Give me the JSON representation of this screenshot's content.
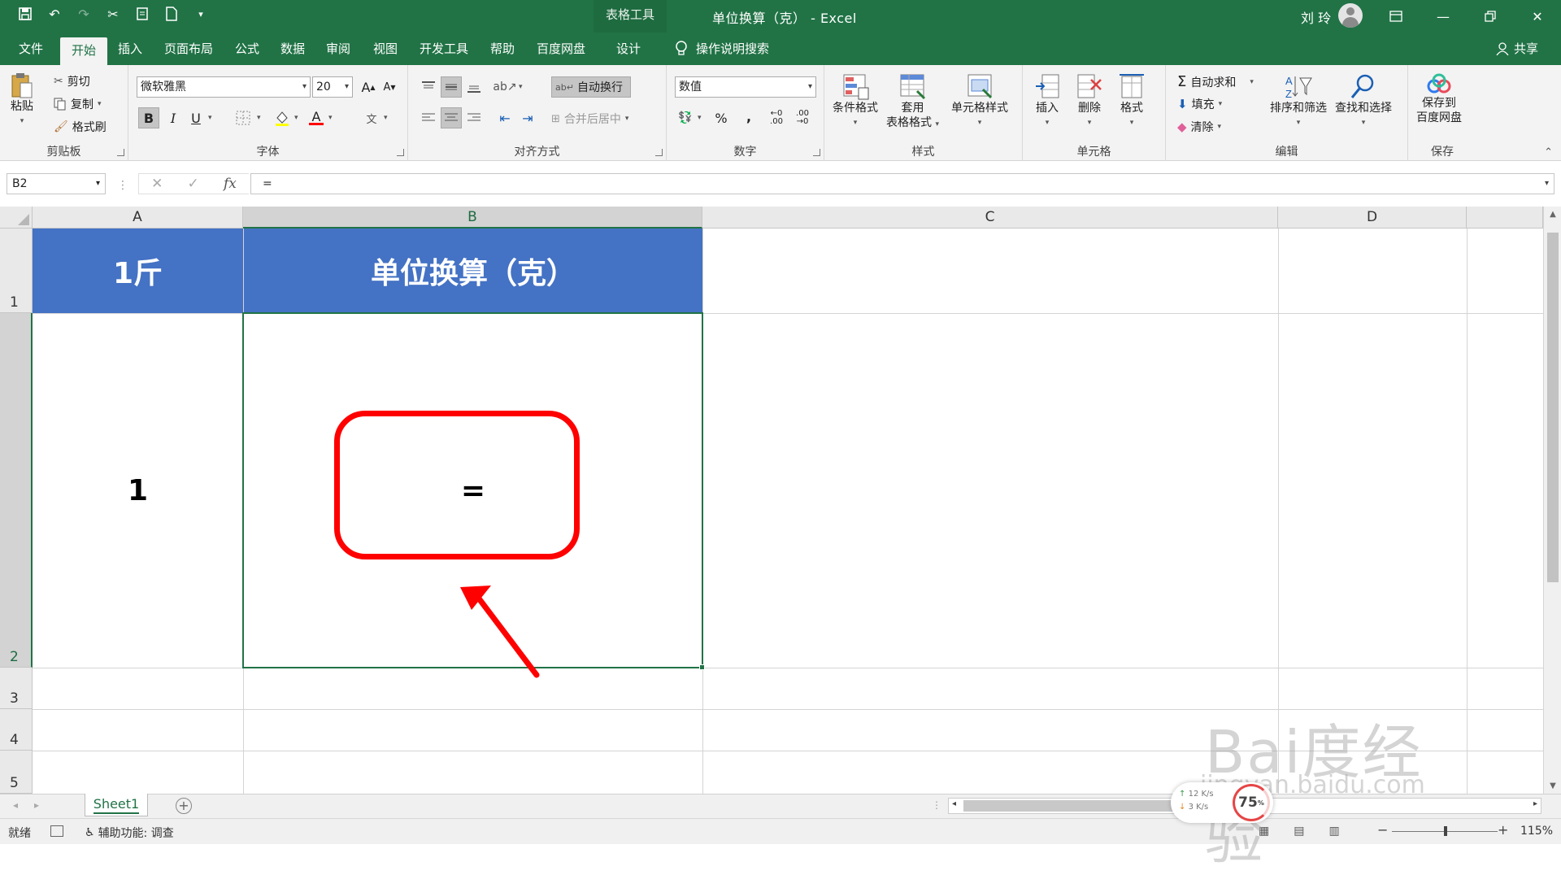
{
  "titlebar": {
    "context_tab_group": "表格工具",
    "doc_title": "单位换算（克） - Excel",
    "user_name": "刘 玲"
  },
  "tabs": [
    {
      "label": "文件"
    },
    {
      "label": "开始"
    },
    {
      "label": "插入"
    },
    {
      "label": "页面布局"
    },
    {
      "label": "公式"
    },
    {
      "label": "数据"
    },
    {
      "label": "审阅"
    },
    {
      "label": "视图"
    },
    {
      "label": "开发工具"
    },
    {
      "label": "帮助"
    },
    {
      "label": "百度网盘"
    },
    {
      "label": "设计"
    }
  ],
  "tell_me": "操作说明搜索",
  "share": "共享",
  "ribbon": {
    "clipboard": {
      "label": "剪贴板",
      "paste": "粘贴",
      "cut": "剪切",
      "copy": "复制",
      "format_painter": "格式刷"
    },
    "font": {
      "label": "字体",
      "font_name": "微软雅黑",
      "font_size": "20",
      "bold": "B",
      "italic": "I",
      "underline": "U"
    },
    "alignment": {
      "label": "对齐方式",
      "wrap_text": "自动换行",
      "merge_center": "合并后居中"
    },
    "number": {
      "label": "数字",
      "format": "数值",
      "percent": "%",
      "comma": ","
    },
    "styles": {
      "label": "样式",
      "conditional": "条件格式",
      "table_format_1": "套用",
      "table_format_2": "表格格式",
      "cell_styles": "单元格样式"
    },
    "cells": {
      "label": "单元格",
      "insert": "插入",
      "delete": "删除",
      "format": "格式"
    },
    "editing": {
      "label": "编辑",
      "autosum": "自动求和",
      "fill": "填充",
      "clear": "清除",
      "sort_filter": "排序和筛选",
      "find_select": "查找和选择"
    },
    "save": {
      "label": "保存",
      "save_to_1": "保存到",
      "save_to_2": "百度网盘"
    }
  },
  "formula_bar": {
    "name_box": "B2",
    "cancel": "✕",
    "enter": "✓",
    "fx": "fx",
    "content": "="
  },
  "grid": {
    "columns": [
      "A",
      "B",
      "C",
      "D"
    ],
    "rows": [
      "1",
      "2",
      "3",
      "4",
      "5"
    ],
    "cells": {
      "A1": "1斤",
      "B1": "单位换算（克）",
      "A2": "1",
      "B2": "="
    },
    "header_fill": "#4472c4"
  },
  "sheet_tabs": {
    "sheets": [
      "Sheet1"
    ],
    "add": "+"
  },
  "statusbar": {
    "ready": "就绪",
    "accessibility": "辅助功能: 调查",
    "zoom": "115%"
  },
  "overlay": {
    "upload_speed": "12 K/s",
    "download_speed": "3 K/s",
    "percent": "75",
    "percent_unit": "%",
    "watermark_brand": "Bai度经验",
    "watermark_url": "jingyan.baidu.com"
  },
  "colors": {
    "excel_green": "#217346",
    "annotation_red": "#ff0000"
  }
}
